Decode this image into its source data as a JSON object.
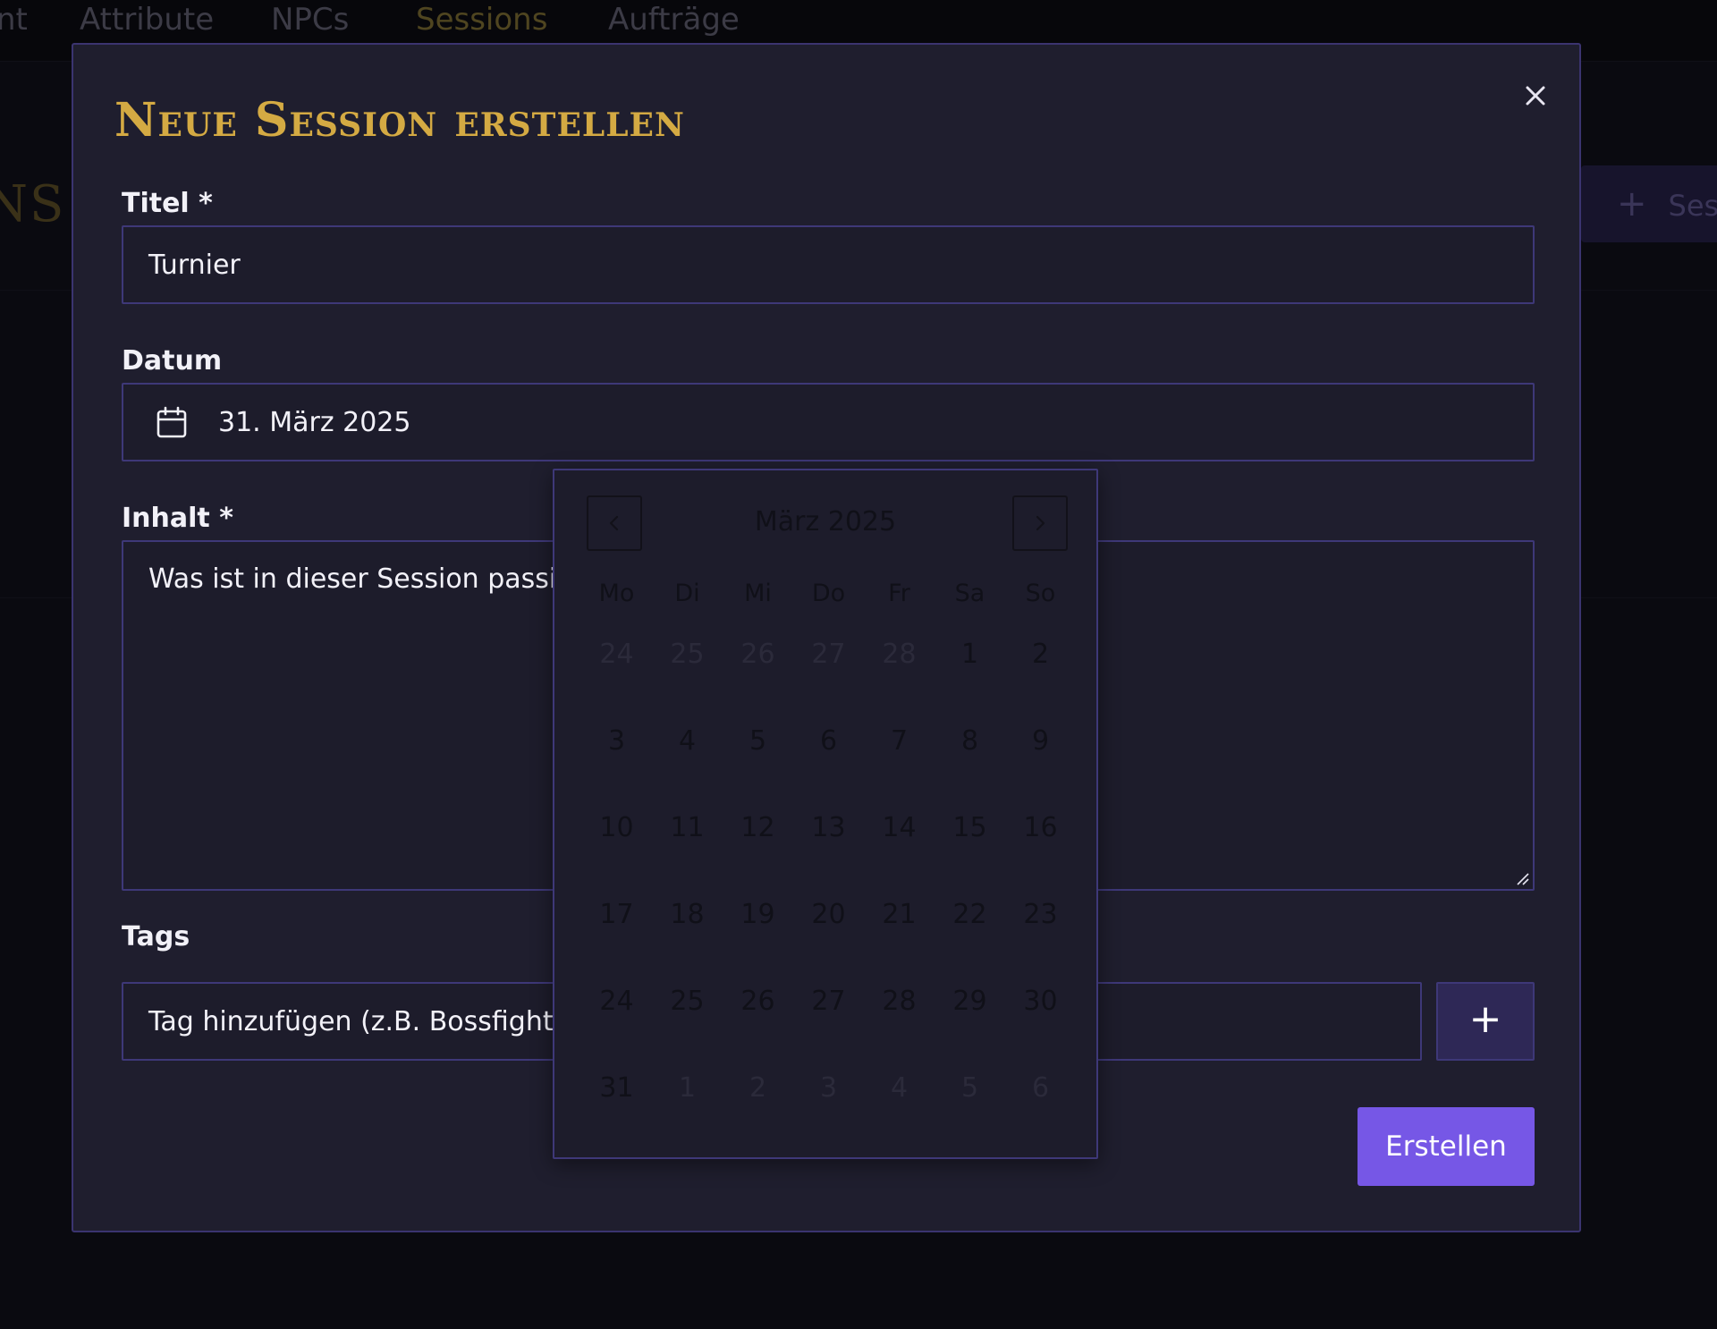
{
  "background": {
    "nav_items": [
      {
        "label": "nt",
        "active": false
      },
      {
        "label": "Attribute",
        "active": false
      },
      {
        "label": "NPCs",
        "active": false
      },
      {
        "label": "Sessions",
        "active": true
      },
      {
        "label": "Aufträge",
        "active": false
      }
    ],
    "page_title_fragment": "NS",
    "new_session_button": {
      "icon": "plus-icon",
      "label": "Ses"
    }
  },
  "modal": {
    "title": "Neue Session erstellen",
    "close_icon": "close-icon",
    "fields": {
      "title": {
        "label": "Titel *",
        "value": "Turnier"
      },
      "date": {
        "label": "Datum",
        "icon": "calendar-icon",
        "value": "31. März 2025"
      },
      "content": {
        "label": "Inhalt *",
        "placeholder": "Was ist in dieser Session passier"
      },
      "tags": {
        "label": "Tags",
        "placeholder": "Tag hinzufügen (z.B. Bossfight, I",
        "add_button": "+"
      }
    },
    "submit_label": "Erstellen"
  },
  "datepicker": {
    "month_label": "März 2025",
    "prev_icon": "chevron-left-icon",
    "next_icon": "chevron-right-icon",
    "weekdays": [
      "Mo",
      "Di",
      "Mi",
      "Do",
      "Fr",
      "Sa",
      "So"
    ],
    "weeks": [
      [
        {
          "d": "24",
          "outside": true
        },
        {
          "d": "25",
          "outside": true
        },
        {
          "d": "26",
          "outside": true
        },
        {
          "d": "27",
          "outside": true
        },
        {
          "d": "28",
          "outside": true
        },
        {
          "d": "1",
          "outside": false
        },
        {
          "d": "2",
          "outside": false
        }
      ],
      [
        {
          "d": "3",
          "outside": false
        },
        {
          "d": "4",
          "outside": false
        },
        {
          "d": "5",
          "outside": false
        },
        {
          "d": "6",
          "outside": false
        },
        {
          "d": "7",
          "outside": false
        },
        {
          "d": "8",
          "outside": false
        },
        {
          "d": "9",
          "outside": false
        }
      ],
      [
        {
          "d": "10",
          "outside": false
        },
        {
          "d": "11",
          "outside": false
        },
        {
          "d": "12",
          "outside": false
        },
        {
          "d": "13",
          "outside": false
        },
        {
          "d": "14",
          "outside": false
        },
        {
          "d": "15",
          "outside": false
        },
        {
          "d": "16",
          "outside": false
        }
      ],
      [
        {
          "d": "17",
          "outside": false
        },
        {
          "d": "18",
          "outside": false
        },
        {
          "d": "19",
          "outside": false
        },
        {
          "d": "20",
          "outside": false
        },
        {
          "d": "21",
          "outside": false
        },
        {
          "d": "22",
          "outside": false
        },
        {
          "d": "23",
          "outside": false
        }
      ],
      [
        {
          "d": "24",
          "outside": false
        },
        {
          "d": "25",
          "outside": false
        },
        {
          "d": "26",
          "outside": false
        },
        {
          "d": "27",
          "outside": false
        },
        {
          "d": "28",
          "outside": false
        },
        {
          "d": "29",
          "outside": false
        },
        {
          "d": "30",
          "outside": false
        }
      ],
      [
        {
          "d": "31",
          "outside": false
        },
        {
          "d": "1",
          "outside": true
        },
        {
          "d": "2",
          "outside": true
        },
        {
          "d": "3",
          "outside": true
        },
        {
          "d": "4",
          "outside": true
        },
        {
          "d": "5",
          "outside": true
        },
        {
          "d": "6",
          "outside": true
        }
      ]
    ]
  },
  "colors": {
    "accent_gold": "#d4aa43",
    "primary_purple": "#7657e6",
    "modal_background": "#1f1e2e",
    "border_purple": "#3e3878"
  }
}
